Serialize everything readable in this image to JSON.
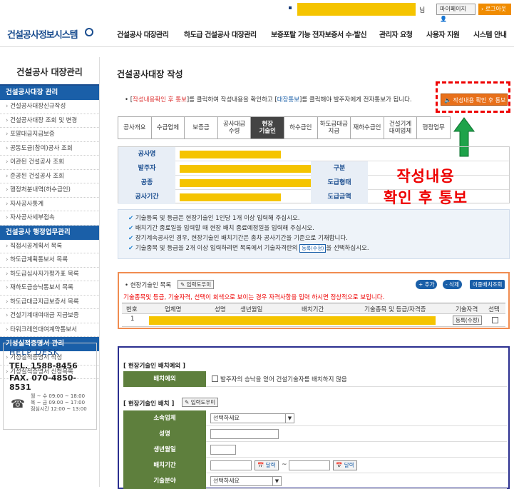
{
  "header": {
    "user_suffix": "님",
    "mypage_label": "마이페이지 👤",
    "logout_label": "› 로그아웃",
    "logo": "건설공사정보시스템"
  },
  "gnb": [
    "건설공사 대장관리",
    "하도급 건설공사 대장관리",
    "보증포탈 기능 전자보증서 수·발신",
    "관리자 요청",
    "사용자 지원",
    "시스템 안내"
  ],
  "sidebar": {
    "title": "건설공사 대장관리",
    "sections": [
      {
        "head": "건설공사대장 관리",
        "items": [
          "건설공사대장신규작성",
          "건설공사대장 조회 및 변경",
          "포말대금지급보증",
          "공동도급(참여)공사 조회",
          "이관된 건설공사 조회",
          "준공된 건설공사 조회",
          "행정처분내역(하수급인)",
          "자사공사통계",
          "자사공사세부접속"
        ]
      },
      {
        "head": "건설공사 행정업무관리",
        "items": [
          "직접시공계획서 목록",
          "하도급계획통보서 목록",
          "하도급심사자가평가표 목록",
          "재하도급승낙통보서 목록",
          "하도급대금지급보증서 목록",
          "건설기계대여대금 지급보증",
          "타워크레인대여계약통보서"
        ]
      },
      {
        "head": "기성실적증명서 관리",
        "items": [
          "기성실적증명서 작성",
          "기성실적증명서 신청목록"
        ]
      }
    ]
  },
  "helpdesk": {
    "title": "HELP DESK",
    "tel": "TEL. 1588-8456",
    "fax": "FAX. 070-4850-8531",
    "hours": [
      "월 ~ 수   09:00 ~ 18:00",
      "목 ~ 금   09:00 ~ 17:00",
      "점심시간   12:00 ~ 13:00"
    ]
  },
  "main": {
    "title": "건설공사대장 작성",
    "notice_prefix": "• [",
    "notice_a": "작성내용확인 후 통보",
    "notice_mid": "]를 클릭하여 작성내용을 확인하고 [",
    "notice_b": "대장통보",
    "notice_suffix": "]를 클릭해야 발주자에게 전자통보가 됩니다.",
    "confirm_button": "🔈 작성내용 확인 후 통보",
    "overlay_line1": "작성내용",
    "overlay_line2": "확인 후 통보"
  },
  "tabs": [
    {
      "l1": "공사개요",
      "l2": ""
    },
    {
      "l1": "수급업체",
      "l2": ""
    },
    {
      "l1": "보증금",
      "l2": ""
    },
    {
      "l1": "공사대금",
      "l2": "수령"
    },
    {
      "l1": "현장",
      "l2": "기술인"
    },
    {
      "l1": "하수급인",
      "l2": ""
    },
    {
      "l1": "하도급대금",
      "l2": "지급"
    },
    {
      "l1": "재하수급인",
      "l2": ""
    },
    {
      "l1": "건설기계",
      "l2": "대여업체"
    },
    {
      "l1": "행정업무",
      "l2": ""
    }
  ],
  "info": {
    "r1": "공사명",
    "r2": "발주자",
    "r3": "공종",
    "r4": "공사기간",
    "r2b": "구분",
    "r3b": "도급형태",
    "r4b": "도급금액"
  },
  "guide": [
    "기술등록 및 등급은 현장기술인 1인당 1개 이상 입력해 주십시오.",
    "배치기간 종료일을 입력할 때 현장 배치 종료예정일을 입력해 주십시오.",
    "장기계속공사인 경우, 현장기술인 배치기간은 총차 공사기간을 기준으로 기재합니다.",
    "기술종목 및 등급을 2개 이상 입력하려면 목록에서 기술자격란의"
  ],
  "guide_tag": "등록(수정)",
  "guide_tail": "을 선택하십시오.",
  "engineers": {
    "title": "• 현장기술인 목록",
    "help_btn": "✎ 입력도우미",
    "add_btn": "+ 추가",
    "del_btn": "- 삭제",
    "move_btn": "이중배치조회",
    "warning": "기술종목및 등급, 기술자격, 선택이 회색으로 보이는 경우 자격사항을 입력 하시면 정상적으로 보입니다.",
    "cols": [
      "번호",
      "업체명",
      "성명",
      "생년월일",
      "배치기간",
      "기술종목 및 등급/자격증",
      "기술자격",
      "선택"
    ],
    "row_no": "1",
    "row_btn": "등록(수정)"
  },
  "form": {
    "sec1": "[ 현장기술인 배치예외 ]",
    "exclude_label": "배치예외",
    "exclude_text": "발주자의 승낙을 얻어 건설기술자를 배치하지 않음",
    "sec2": "[ 현장기술인 배치 ]",
    "help_btn": "✎ 입력도우미",
    "company_label": "소속업체",
    "company_value": "선택하세요",
    "name_label": "성명",
    "birth_label": "생년월일",
    "period_label": "배치기간",
    "cal_btn": "📅 달력",
    "tilde": "~",
    "field_label": "기술분야",
    "field_value": "선택하세요"
  },
  "colors": {
    "accent": "#1a5fa8",
    "highlight": "#f5c400",
    "warning": "#e00000",
    "form_label": "#5e7f3d"
  }
}
